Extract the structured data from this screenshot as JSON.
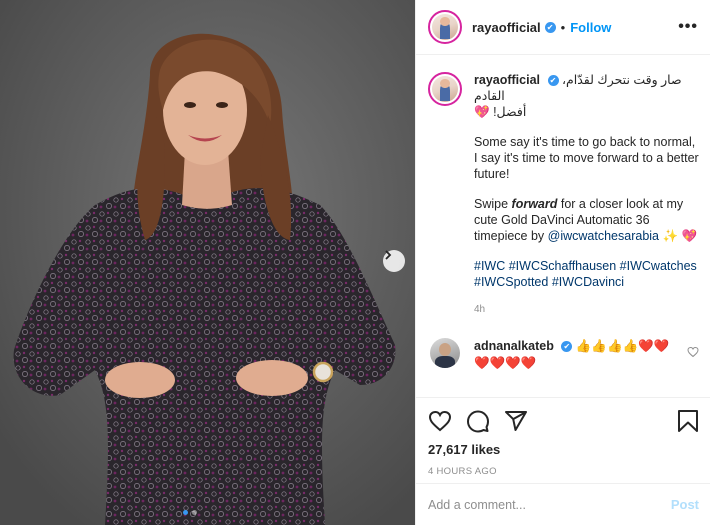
{
  "header": {
    "username": "rayaofficial",
    "verified_mark": "✔",
    "separator": "•",
    "follow_label": "Follow",
    "more_label": "•••"
  },
  "caption": {
    "username": "rayaofficial",
    "arabic_line1": "صار وقت نتحرك لقدّام، القادم",
    "arabic_line2": "أفضل!",
    "heart_emoji": "💖",
    "para1": "Some say it's time to go back to normal, I say it's time to move forward to a better future!",
    "para2_prefix": "Swipe ",
    "para2_emph": "forward",
    "para2_mid": " for a closer look at my cute Gold DaVinci Automatic 36 timepiece by ",
    "para2_tag": "@iwcwatchesarabia",
    "para2_emoji1": "✨",
    "para2_emoji2": "💖",
    "hashtags": "#IWC #IWCSchaffhausen #IWCwatches #IWCSpotted #IWCDavinci",
    "time_ago": "4h"
  },
  "comment": {
    "username": "adnanalkateb",
    "verified_mark": "✔",
    "emojis": "👍👍👍👍❤️❤️ ❤️❤️❤️❤️"
  },
  "actions": {
    "likes": "27,617 likes",
    "date": "4 HOURS AGO"
  },
  "add_comment": {
    "placeholder": "Add a comment...",
    "post_label": "Post"
  },
  "colors": {
    "accent": "#0095f6",
    "verified": "#3897f0",
    "link": "#00376b",
    "muted": "#8e8e8e"
  },
  "icons": [
    "more-icon",
    "heart-icon",
    "comment-icon",
    "share-icon",
    "bookmark-icon",
    "next-arrow-icon",
    "verified-badge-icon"
  ]
}
